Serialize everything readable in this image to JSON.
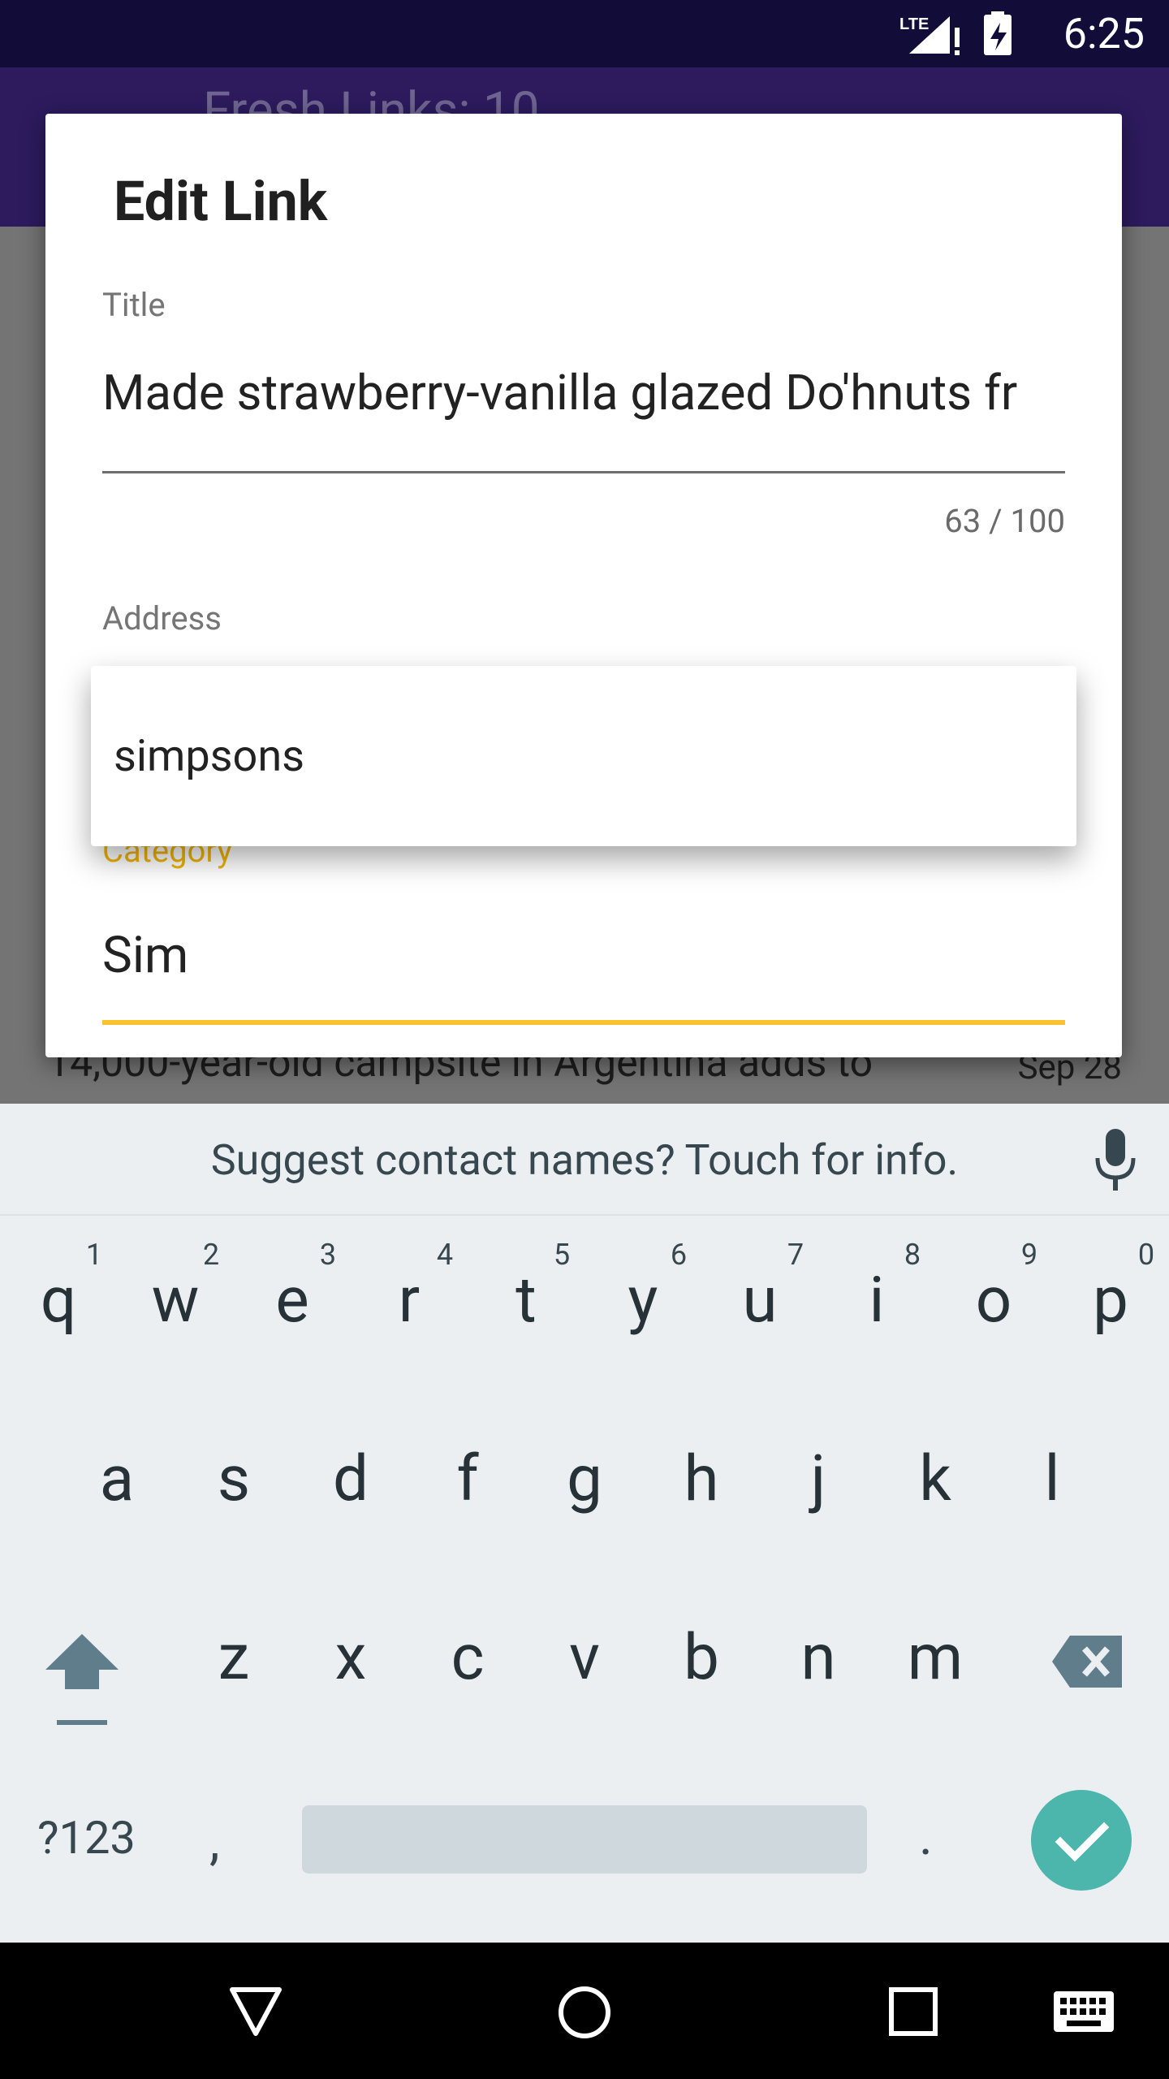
{
  "status_bar": {
    "time": "6:25",
    "network_label": "LTE"
  },
  "background_app": {
    "title": "Fresh Links: 10",
    "row_text": "14,000-year-old campsite in Argentina adds to",
    "row_date": "Sep 28"
  },
  "dialog": {
    "title": "Edit Link",
    "title_label": "Title",
    "title_value": "Made strawberry-vanilla glazed Do'hnuts fr",
    "title_counter": "63 / 100",
    "address_label": "Address",
    "category_label": "Category",
    "category_value": "Sim"
  },
  "autocomplete": {
    "items": [
      "simpsons"
    ]
  },
  "keyboard": {
    "suggestion": "Suggest contact names? Touch for info.",
    "row1": [
      "q",
      "w",
      "e",
      "r",
      "t",
      "y",
      "u",
      "i",
      "o",
      "p"
    ],
    "row1_hints": [
      "1",
      "2",
      "3",
      "4",
      "5",
      "6",
      "7",
      "8",
      "9",
      "0"
    ],
    "row2": [
      "a",
      "s",
      "d",
      "f",
      "g",
      "h",
      "j",
      "k",
      "l"
    ],
    "row3": [
      "z",
      "x",
      "c",
      "v",
      "b",
      "n",
      "m"
    ],
    "symbols_label": "?123",
    "comma": ",",
    "period": "."
  },
  "colors": {
    "accent": "#fbc02d",
    "category_label": "#f1b500",
    "app_bar": "#2d1b5e",
    "status_bar": "#110c38",
    "enter_key": "#4db6ac"
  },
  "icons": {
    "status": [
      "lte-signal-icon",
      "battery-icon"
    ],
    "nav": [
      "back-icon",
      "home-icon",
      "recents-icon",
      "keyboard-switch-icon"
    ]
  }
}
